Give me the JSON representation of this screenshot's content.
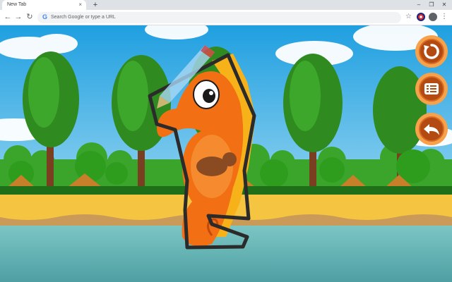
{
  "browser": {
    "tab_title": "New Tab",
    "tab_close": "×",
    "new_tab": "+",
    "window_controls": {
      "minimize": "–",
      "restore": "❐",
      "close": "✕"
    },
    "nav": {
      "back": "←",
      "forward": "→",
      "reload": "↻"
    },
    "omnibox_placeholder": "Search Google or type a URL",
    "google_glyph": "G",
    "star": "☆",
    "menu": "⋮"
  },
  "game": {
    "character": "seahorse",
    "buttons": [
      {
        "name": "restart",
        "icon": "restart-icon"
      },
      {
        "name": "menu",
        "icon": "list-icon"
      },
      {
        "name": "back",
        "icon": "back-arrow-icon"
      }
    ],
    "colors": {
      "sky": "#27a9e6",
      "grass": "#2e9d1e",
      "sand": "#f5c440",
      "water": "#6fb7b5",
      "seahorse": "#f26f13",
      "button_ring": "#f5a24a",
      "button_core": "#b34a12"
    }
  }
}
